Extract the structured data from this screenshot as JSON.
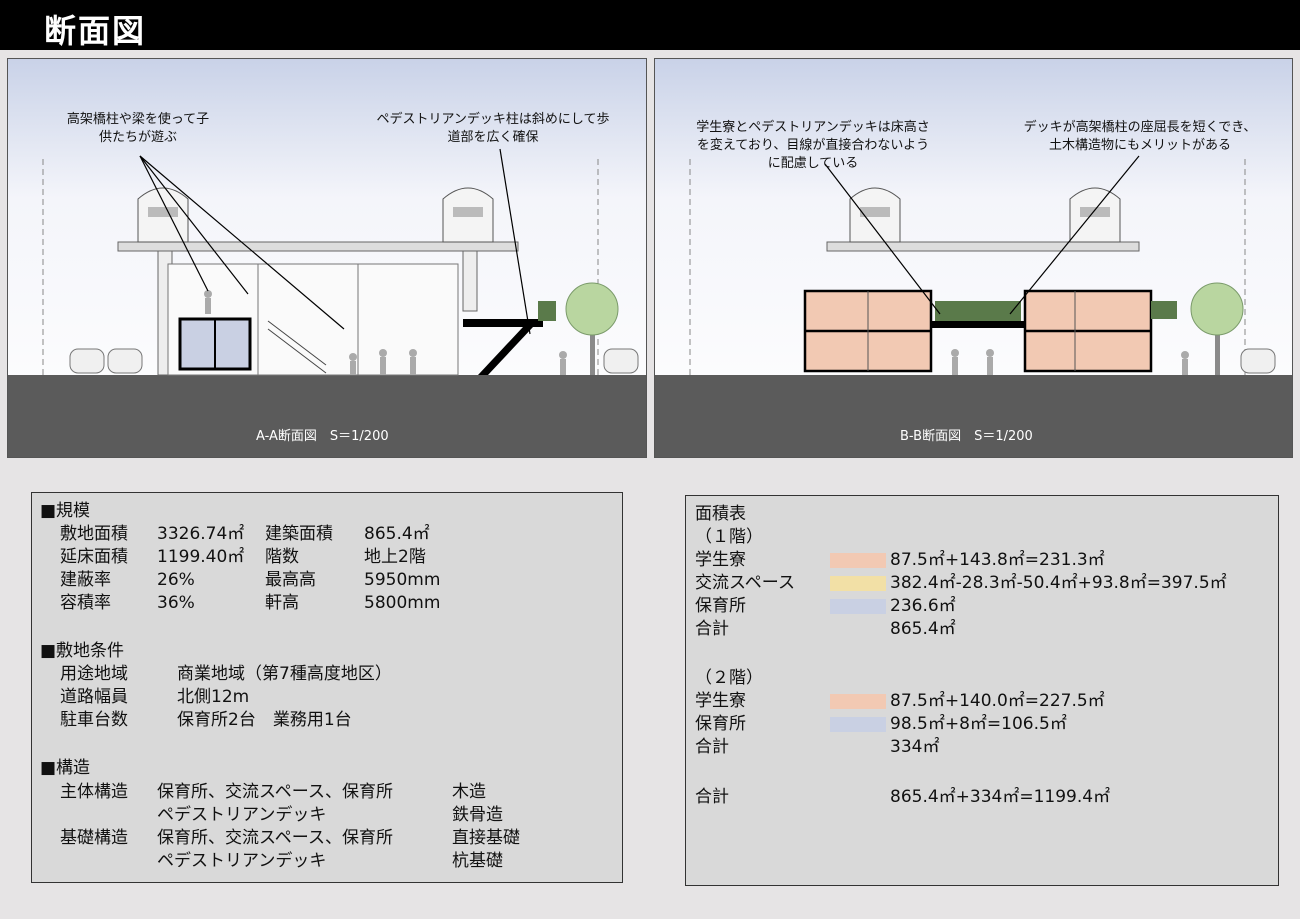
{
  "page_title": "断面図",
  "sectionA": {
    "caption": "A-A断面図　S＝1/200",
    "annotation_left": "高架橋柱や梁を使って子\n供たちが遊ぶ",
    "annotation_right": "ペデストリアンデッキ柱は斜めにして歩\n道部を広く確保"
  },
  "sectionB": {
    "caption": "B-B断面図　S＝1/200",
    "annotation_left": "学生寮とペデストリアンデッキは床高さ\nを変えており、目線が直接合わないよう\nに配慮している",
    "annotation_right": "デッキが高架橋柱の座屈長を短くでき、\n土木構造物にもメリットがある"
  },
  "info": {
    "scale_title": "■規模",
    "scale_rows": [
      [
        "敷地面積",
        "3326.74㎡",
        "建築面積",
        "865.4㎡"
      ],
      [
        "延床面積",
        "1199.40㎡",
        "階数",
        "地上2階"
      ],
      [
        "建蔽率",
        "26%",
        "最高高",
        "5950mm"
      ],
      [
        "容積率",
        "36%",
        "軒高",
        "5800mm"
      ]
    ],
    "site_title": "■敷地条件",
    "site_rows": [
      [
        "用途地域",
        "商業地域（第7種高度地区）"
      ],
      [
        "道路幅員",
        "北側12m"
      ],
      [
        "駐車台数",
        "保育所2台　業務用1台"
      ]
    ],
    "structure_title": "■構造",
    "structure_rows": [
      [
        "主体構造",
        "保育所、交流スペース、保育所",
        "木造"
      ],
      [
        "",
        "ペデストリアンデッキ",
        "鉄骨造"
      ],
      [
        "基礎構造",
        "保育所、交流スペース、保育所",
        "直接基礎"
      ],
      [
        "",
        "ペデストリアンデッキ",
        "杭基礎"
      ]
    ]
  },
  "area_table": {
    "title": "面積表",
    "floor1_title": "（１階）",
    "floor1_rows": [
      {
        "label": "学生寮",
        "value": "87.5㎡+143.8㎡=231.3㎡",
        "color": "#f2c9b3"
      },
      {
        "label": "交流スペース",
        "value": "382.4㎡-28.3㎡-50.4㎡+93.8㎡=397.5㎡",
        "color": "#f2e0a6"
      },
      {
        "label": "保育所",
        "value": "236.6㎡",
        "color": "#c9d0e3"
      },
      {
        "label": "合計",
        "value": "865.4㎡",
        "color": ""
      }
    ],
    "floor2_title": "（２階）",
    "floor2_rows": [
      {
        "label": "学生寮",
        "value": "87.5㎡+140.0㎡=227.5㎡",
        "color": "#f2c9b3"
      },
      {
        "label": "保育所",
        "value": "98.5㎡+8㎡=106.5㎡",
        "color": "#c9d0e3"
      },
      {
        "label": "合計",
        "value": "334㎡",
        "color": ""
      }
    ],
    "total_label": "合計",
    "total_value": "865.4㎡+334㎡=1199.4㎡"
  },
  "colors": {
    "sky_top": "#c9d2e8",
    "ground": "#5b5b5b",
    "title_bg": "#000000"
  }
}
